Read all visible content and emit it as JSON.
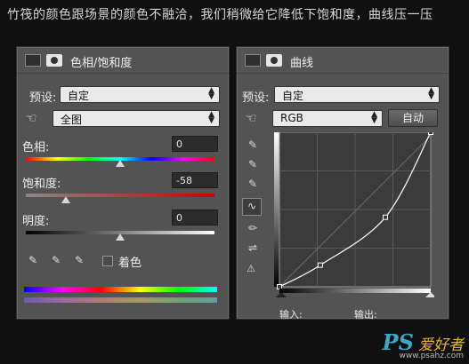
{
  "caption": "竹筏的颜色跟场景的颜色不融洽，我们稍微给它降低下饱和度，曲线压一压",
  "hue_saturation": {
    "title": "色相/饱和度",
    "preset_label": "预设:",
    "preset_value": "自定",
    "channel_value": "全图",
    "hue_label": "色相:",
    "hue_value": "0",
    "saturation_label": "饱和度:",
    "saturation_value": "-58",
    "lightness_label": "明度:",
    "lightness_value": "0",
    "colorize_label": "着色",
    "hue_level": 0,
    "saturation_level": -58,
    "lightness_level": 0
  },
  "curves": {
    "title": "曲线",
    "preset_label": "预设:",
    "preset_value": "自定",
    "channel_value": "RGB",
    "auto_button": "自动",
    "input_label": "输入:",
    "output_label": "输出:",
    "points": [
      [
        0,
        0
      ],
      [
        27,
        14
      ],
      [
        70,
        45
      ],
      [
        100,
        100
      ]
    ]
  },
  "watermark": {
    "brand": "PS",
    "tagline": "爱好者",
    "url": "www.psahz.com"
  }
}
